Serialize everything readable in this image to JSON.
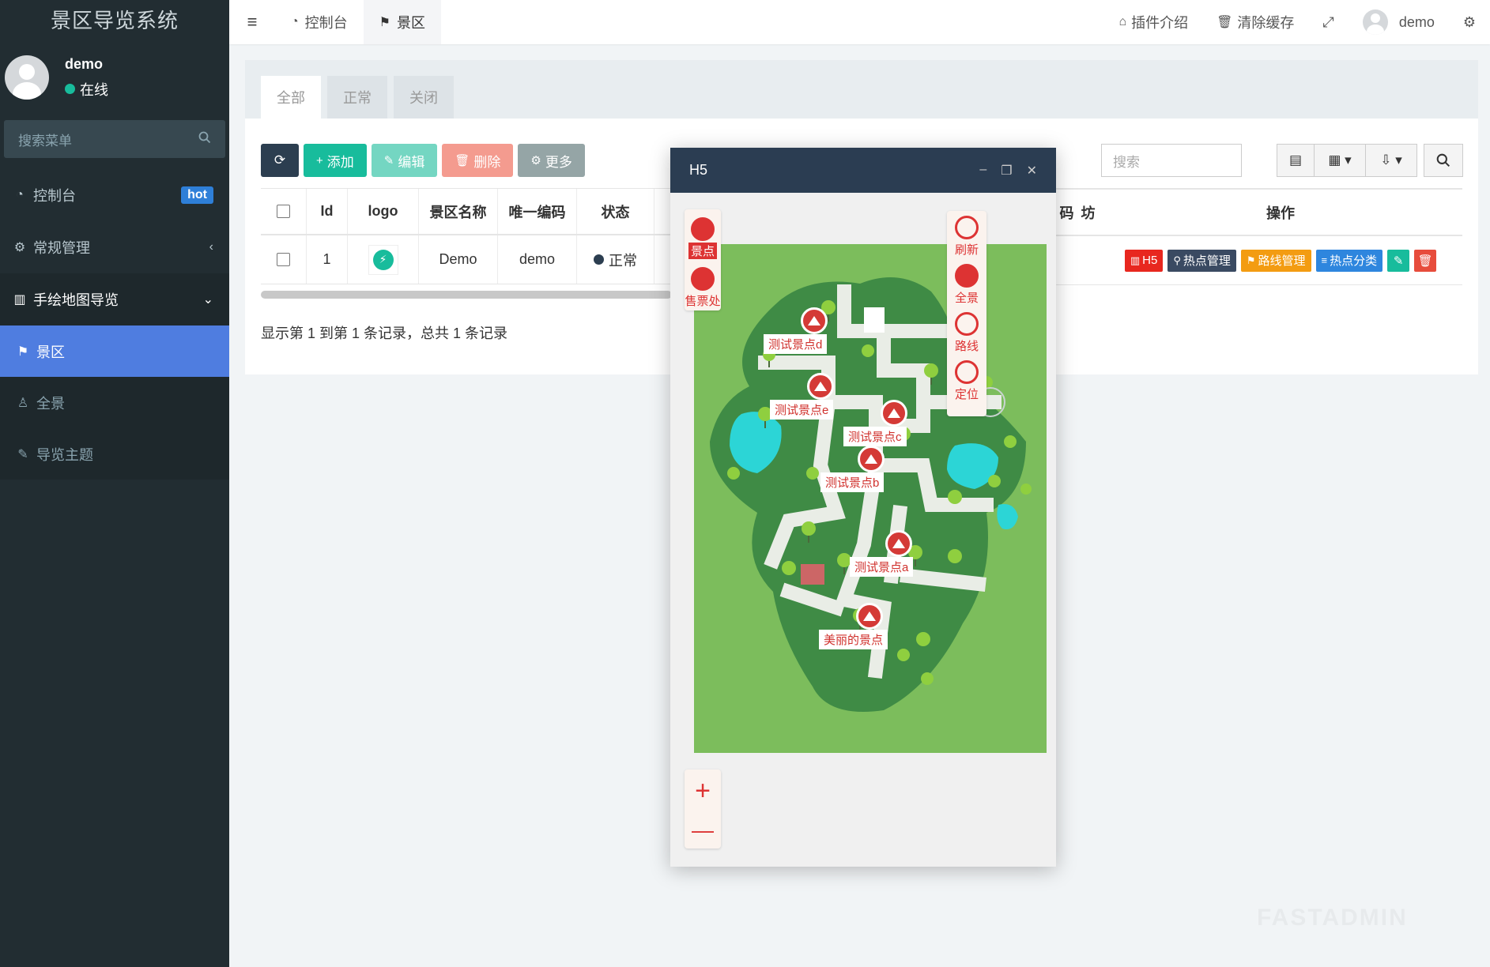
{
  "app": {
    "title": "景区导览系统",
    "user": {
      "name": "demo",
      "status": "在线"
    },
    "search_placeholder": "搜索菜单"
  },
  "sidebar": {
    "items": [
      {
        "label": "控制台",
        "icon": "dashboard-icon",
        "badge": "hot"
      },
      {
        "label": "常规管理",
        "icon": "cogs-icon",
        "arrow": "‹"
      },
      {
        "label": "手绘地图导览",
        "icon": "map-icon",
        "arrow": "⌄"
      }
    ],
    "sub_items": [
      {
        "label": "景区",
        "icon": "signpost-icon",
        "active": true
      },
      {
        "label": "全景",
        "icon": "street-view-icon"
      },
      {
        "label": "导览主题",
        "icon": "brush-icon"
      }
    ]
  },
  "header": {
    "tabs": [
      {
        "label": "控制台",
        "icon": "dashboard-icon"
      },
      {
        "label": "景区",
        "icon": "signpost-icon"
      }
    ],
    "right": {
      "plugin": "插件介绍",
      "clear_cache": "清除缓存",
      "username": "demo"
    }
  },
  "content": {
    "filter_tabs": [
      "全部",
      "正常",
      "关闭"
    ],
    "toolbar": {
      "add": "添加",
      "edit": "编辑",
      "delete": "删除",
      "more": "更多"
    },
    "search_placeholder": "搜索",
    "columns": [
      "Id",
      "logo",
      "景区名称",
      "唯一编码",
      "状态"
    ],
    "partial_columns": [
      "码",
      "坊"
    ],
    "ops_header": "操作",
    "rows": [
      {
        "id": "1",
        "name": "Demo",
        "code": "demo",
        "status": "正常"
      }
    ],
    "ops": {
      "h5": "H5",
      "hot": "热点管理",
      "route": "路线管理",
      "category": "热点分类"
    },
    "footer": "显示第 1 到第 1 条记录，总共 1 条记录"
  },
  "modal": {
    "title": "H5",
    "left_panel": [
      "景点",
      "售票处"
    ],
    "right_panel": [
      "刷新",
      "全景",
      "路线",
      "定位"
    ],
    "zoom": [
      "+",
      "—"
    ],
    "spots": [
      "测试景点d",
      "测试景点e",
      "测试景点c",
      "测试景点b",
      "测试景点a",
      "美丽的景点"
    ]
  },
  "colors": {
    "sidebar_bg": "#222d32",
    "active_blue": "#4f7de0",
    "success": "#18bc9c",
    "danger": "#e74c3c",
    "map_green": "#7cbd5c"
  }
}
